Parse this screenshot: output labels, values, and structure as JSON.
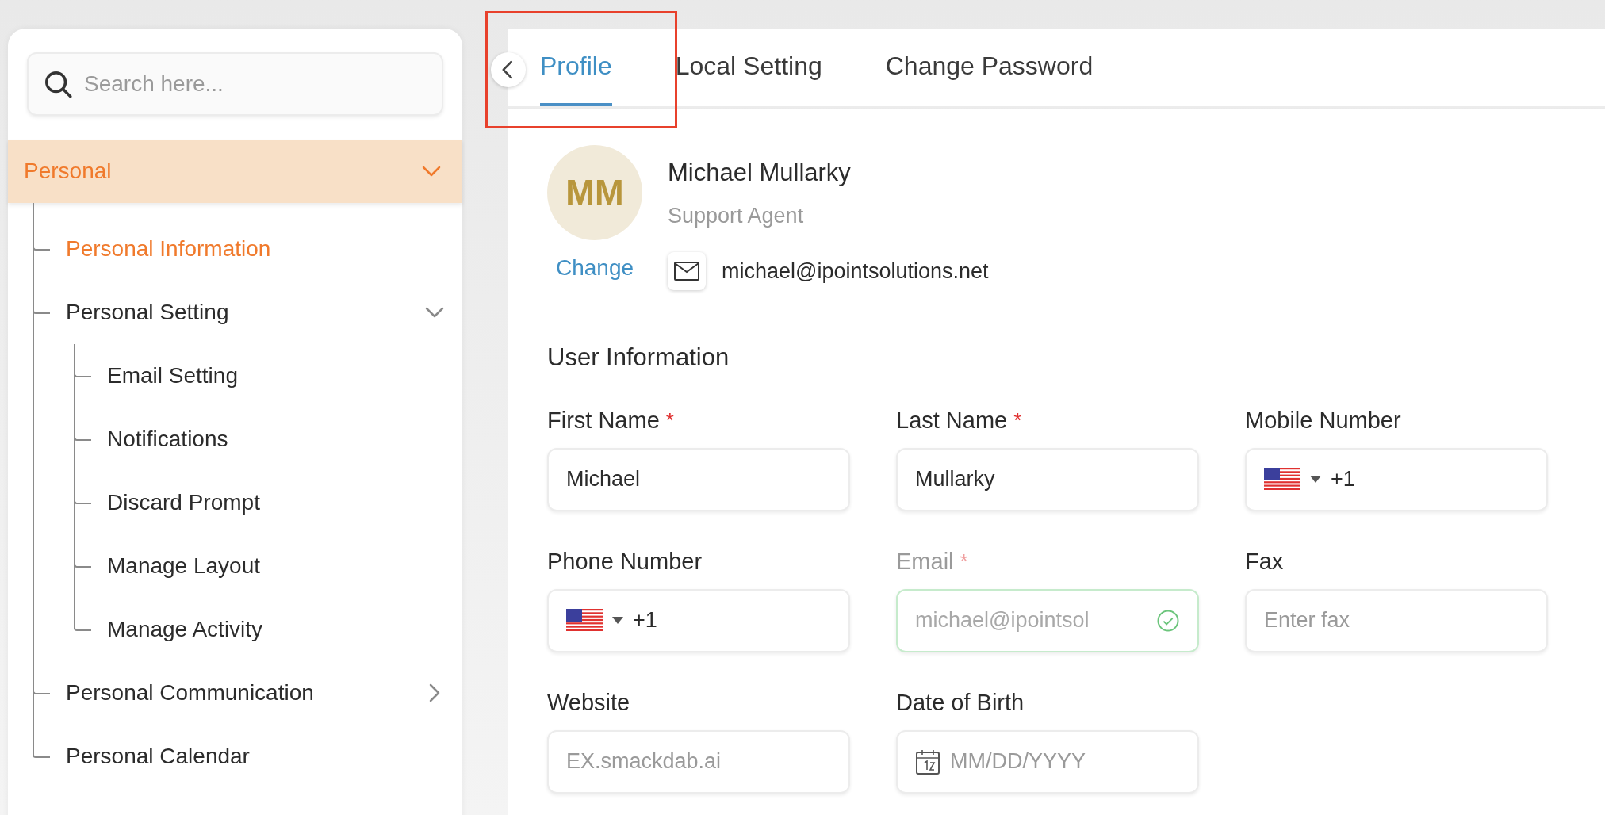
{
  "sidebar": {
    "search": {
      "placeholder": "Search here..."
    },
    "section": {
      "label": "Personal",
      "expanded": true,
      "items": [
        {
          "label": "Personal Information",
          "selected": true
        },
        {
          "label": "Personal Setting",
          "selected": false,
          "expanded": true,
          "children": [
            {
              "label": "Email Setting",
              "selected": false
            },
            {
              "label": "Notifications",
              "selected": false
            },
            {
              "label": "Discard Prompt",
              "selected": false
            },
            {
              "label": "Manage Layout",
              "selected": false
            },
            {
              "label": "Manage Activity",
              "selected": false
            }
          ]
        },
        {
          "label": "Personal Communication",
          "selected": false,
          "expanded": false
        },
        {
          "label": "Personal Calendar",
          "selected": false
        }
      ]
    }
  },
  "tabs": [
    {
      "label": "Profile",
      "selected": true,
      "highlighted": true
    },
    {
      "label": "Local Setting",
      "selected": false,
      "highlighted": false
    },
    {
      "label": "Change Password",
      "selected": false,
      "highlighted": false
    }
  ],
  "profile": {
    "initials": "MM",
    "change_link": "Change",
    "name": "Michael Mullarky",
    "role": "Support Agent",
    "email": "michael@ipointsolutions.net"
  },
  "form": {
    "title": "User Information",
    "fields": [
      {
        "kind": "text",
        "label": "First Name",
        "required_mark": "*",
        "value": "Michael"
      },
      {
        "kind": "text",
        "label": "Last Name",
        "required_mark": "*",
        "value": "Mullarky"
      },
      {
        "kind": "phone",
        "label": "Mobile Number",
        "value": "+1"
      },
      {
        "kind": "phone",
        "label": "Phone Number",
        "value": "+1"
      },
      {
        "kind": "email",
        "label": "Email",
        "required_mark": "*",
        "disabled": true,
        "valid": true,
        "value": "michael@ipointsol"
      },
      {
        "kind": "text",
        "label": "Fax",
        "placeholder": "Enter fax"
      },
      {
        "kind": "text",
        "label": "Website",
        "placeholder": "EX.smackdab.ai"
      },
      {
        "kind": "date",
        "label": "Date of Birth",
        "placeholder": "MM/DD/YYYY"
      }
    ]
  }
}
